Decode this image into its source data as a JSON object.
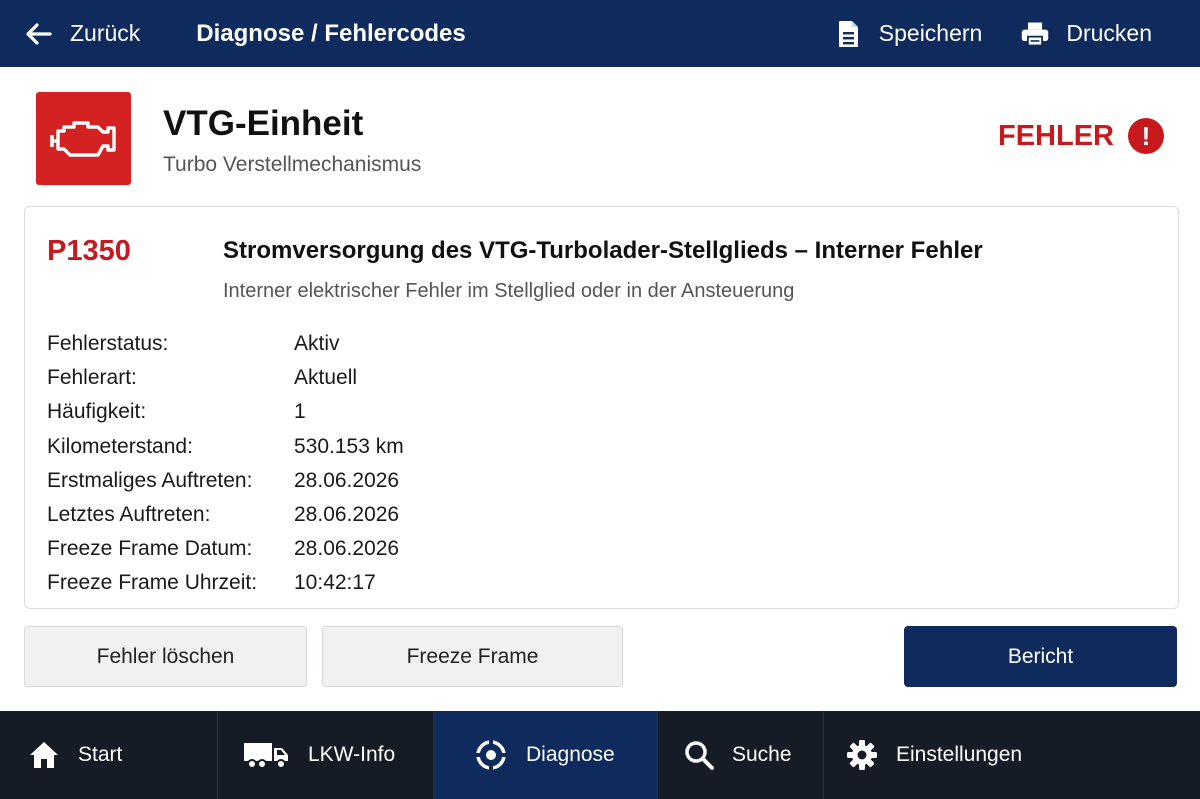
{
  "header": {
    "back_label": "Zurück",
    "title": "Diagnose / Fehlercodes",
    "save_label": "Speichern",
    "print_label": "Drucken"
  },
  "module": {
    "name": "VTG-Einheit",
    "subtitle": "Turbo Verstellmechanismus",
    "status": "FEHLER",
    "status_icon": "!",
    "accent_color": "#d42222"
  },
  "fault": {
    "code": "P1350",
    "title": "Stromversorgung des VTG-Turbolader-Stellglieds – Interner Fehler",
    "description": "Interner elektrischer Fehler im Stellglied oder in der Ansteuerung",
    "details": [
      {
        "label": "Fehlerstatus:",
        "value": "Aktiv"
      },
      {
        "label": "Fehlerart:",
        "value": "Aktuell"
      },
      {
        "label": "Häufigkeit:",
        "value": "1"
      },
      {
        "label": "Kilometerstand:",
        "value": "530.153 km"
      },
      {
        "label": "Erstmaliges Auftreten:",
        "value": "28.06.2026"
      },
      {
        "label": "Letztes Auftreten:",
        "value": "28.06.2026"
      },
      {
        "label": "Freeze Frame Datum:",
        "value": "28.06.2026"
      },
      {
        "label": "Freeze Frame Uhrzeit:",
        "value": "10:42:17"
      }
    ]
  },
  "actions": {
    "clear_label": "Fehler löschen",
    "freeze_label": "Freeze Frame",
    "report_label": "Bericht"
  },
  "nav": {
    "items": [
      {
        "label": "Start",
        "icon": "home-icon"
      },
      {
        "label": "LKW-Info",
        "icon": "truck-icon"
      },
      {
        "label": "Diagnose",
        "icon": "diagnose-icon",
        "active": true
      },
      {
        "label": "Suche",
        "icon": "search-icon"
      },
      {
        "label": "Einstellungen",
        "icon": "gear-icon"
      }
    ]
  },
  "colors": {
    "primary": "#0f2a5c",
    "error": "#c8191e",
    "nav_bg": "#151c25"
  }
}
